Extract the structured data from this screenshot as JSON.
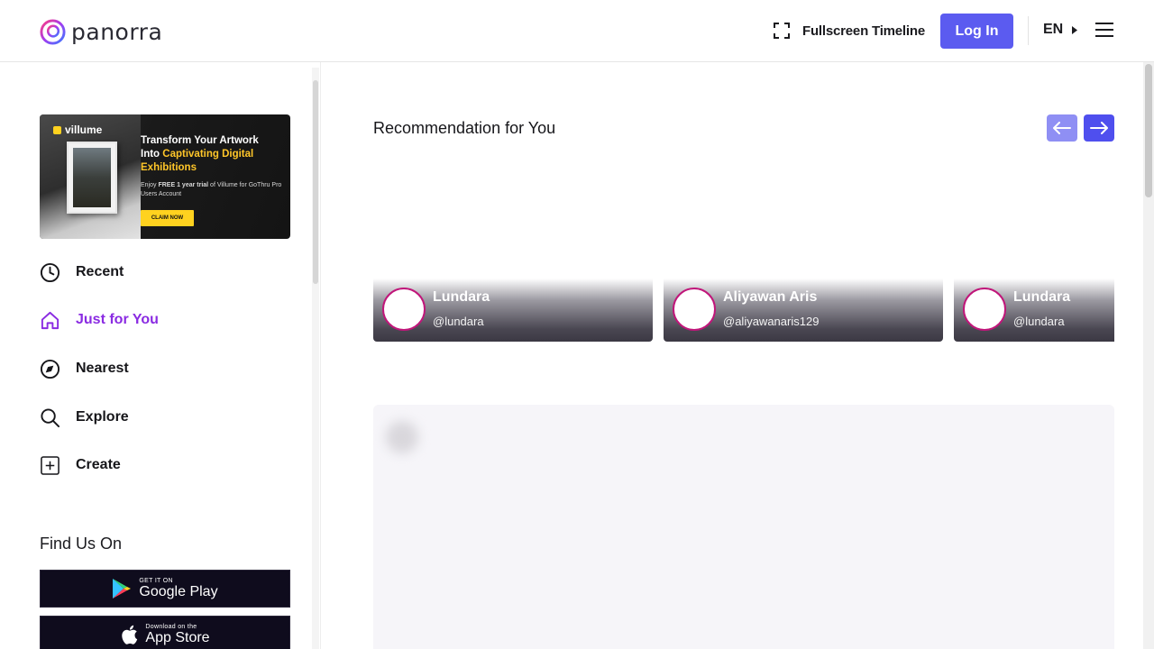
{
  "brand": {
    "name": "panorra",
    "accent": "#5b5bf0",
    "active": "#8a2be2"
  },
  "header": {
    "fullscreen_label": "Fullscreen Timeline",
    "login_label": "Log In",
    "language": "EN"
  },
  "banner": {
    "brand": "villume",
    "title_line1": "Transform Your Artwork",
    "title_into": "Into ",
    "title_highlight": "Captivating Digital Exhibitions",
    "sub_enjoy": "Enjoy ",
    "sub_bold": "FREE 1 year trial",
    "sub_rest": " of Villume for GoThru Pro Users Account",
    "cta": "CLAIM NOW"
  },
  "nav": [
    {
      "label": "Recent",
      "icon": "clock-icon"
    },
    {
      "label": "Just for You",
      "icon": "home-icon",
      "active": true
    },
    {
      "label": "Nearest",
      "icon": "compass-icon"
    },
    {
      "label": "Explore",
      "icon": "search-icon"
    },
    {
      "label": "Create",
      "icon": "plus-square-icon"
    }
  ],
  "find_us": {
    "title": "Find Us On",
    "google_small": "GET IT ON",
    "google_big": "Google Play",
    "apple_small": "Download on the",
    "apple_big": "App Store"
  },
  "main": {
    "recommendation_title": "Recommendation for You",
    "cards": [
      {
        "name": "Lundara",
        "handle": "@lundara"
      },
      {
        "name": "Aliyawan Aris",
        "handle": "@aliyawanaris129"
      },
      {
        "name": "Lundara",
        "handle": "@lundara"
      }
    ]
  }
}
